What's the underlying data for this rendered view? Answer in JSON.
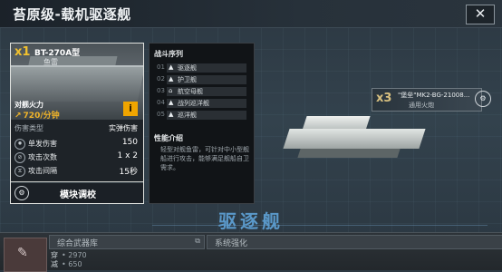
{
  "header": {
    "title": "苔原级-载机驱逐舰",
    "close_label": "✕"
  },
  "weapon_card": {
    "quantity": "x1",
    "name": "BT-270A型",
    "type": "鱼雷",
    "firepower_label": "对舰火力",
    "firepower_value": "720/分钟",
    "firepower_glyph": "↗",
    "info_label": "i",
    "damage_type_label": "伤害类型",
    "damage_type_value": "实弹伤害",
    "stats": [
      {
        "icon": "✹",
        "label": "单发伤害",
        "value": "150"
      },
      {
        "icon": "⊘",
        "label": "攻击次数",
        "value": "1 x 2"
      },
      {
        "icon": "⧖",
        "label": "攻击间隔",
        "value": "15秒"
      }
    ],
    "module_button_icon": "⚙",
    "module_button_label": "模块调校"
  },
  "battle_sequence": {
    "title": "战斗序列",
    "items": [
      {
        "num": "01",
        "icon": "▲",
        "label": "驱逐舰"
      },
      {
        "num": "02",
        "icon": "▲",
        "label": "护卫舰"
      },
      {
        "num": "03",
        "icon": "⌂",
        "label": "航空母舰"
      },
      {
        "num": "04",
        "icon": "▲",
        "label": "战列巡洋舰"
      },
      {
        "num": "05",
        "icon": "▲",
        "label": "巡洋舰"
      }
    ],
    "performance_title": "性能介绍",
    "performance_text": "轻型对舰鱼雷，可针对中小型舰船进行攻击，能够满足舰船自卫需求。"
  },
  "ammo": {
    "quantity": "x3",
    "name": "\"堡垒\"MK2-BG-21008...",
    "type": "通用火炮",
    "settings_icon": "⚙"
  },
  "ship_class": "驱逐舰",
  "bottom": {
    "thumb_icon": "✎",
    "left_tab": "综合武器库",
    "left_tab_icon": "⧉",
    "right_tab": "系统强化",
    "values": [
      {
        "key": "穿",
        "value": "• 2970"
      },
      {
        "key": "减",
        "value": "• 650"
      }
    ]
  }
}
